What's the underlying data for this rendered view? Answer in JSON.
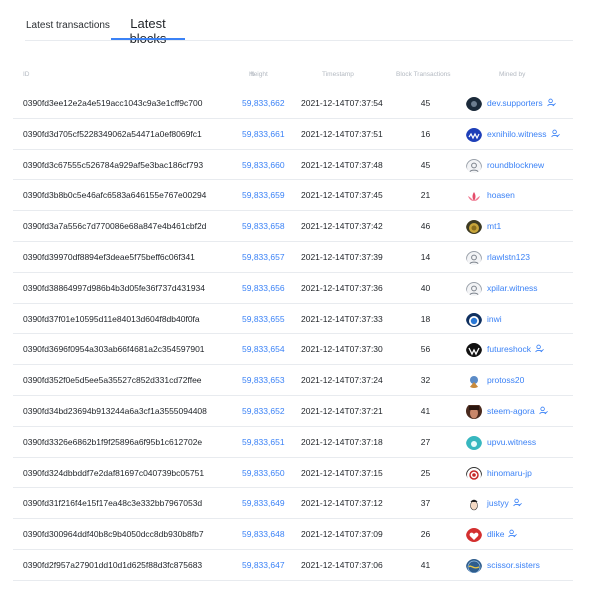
{
  "tabs": {
    "transactions": "Latest transactions",
    "blocks": "Latest blocks"
  },
  "table": {
    "headers": {
      "id": "ID",
      "height": "Height",
      "timestamp": "Timestamp",
      "block_transactions": "Block Transactions",
      "mined_by": "Mined by"
    },
    "rows": [
      {
        "id": "0390fd3ee12e2a4e519acc1043c9a3e1cff9c700",
        "height": "59,833,662",
        "timestamp": "2021-12-14T07:37:54",
        "count": "45",
        "miner": "dev.supporters",
        "verified": true,
        "avatar": "dark-circle-avatar"
      },
      {
        "id": "0390fd3d705cf5228349062a54471a0ef8069fc1",
        "height": "59,833,661",
        "timestamp": "2021-12-14T07:37:51",
        "count": "16",
        "miner": "exnihilo.witness",
        "verified": true,
        "avatar": "blue-wave-avatar"
      },
      {
        "id": "0390fd3c67555c526784a929af5e3bac186cf793",
        "height": "59,833,660",
        "timestamp": "2021-12-14T07:37:48",
        "count": "45",
        "miner": "roundblocknew",
        "verified": false,
        "avatar": "default-user-avatar"
      },
      {
        "id": "0390fd3b8b0c5e46afc6583a646155e767e00294",
        "height": "59,833,659",
        "timestamp": "2021-12-14T07:37:45",
        "count": "21",
        "miner": "hoasen",
        "verified": false,
        "avatar": "lotus-avatar"
      },
      {
        "id": "0390fd3a7a556c7d770086e68a847e4b461cbf2d",
        "height": "59,833,658",
        "timestamp": "2021-12-14T07:37:42",
        "count": "46",
        "miner": "mt1",
        "verified": false,
        "avatar": "gold-coin-avatar"
      },
      {
        "id": "0390fd39970df8894ef3deae5f75beff6c06f341",
        "height": "59,833,657",
        "timestamp": "2021-12-14T07:37:39",
        "count": "14",
        "miner": "rlawlstn123",
        "verified": false,
        "avatar": "default-user-avatar"
      },
      {
        "id": "0390fd38864997d986b4b3d05fe36f737d431934",
        "height": "59,833,656",
        "timestamp": "2021-12-14T07:37:36",
        "count": "40",
        "miner": "xpilar.witness",
        "verified": false,
        "avatar": "default-user-avatar"
      },
      {
        "id": "0390fd37f01e10595d11e84013d604f8db40f0fa",
        "height": "59,833,655",
        "timestamp": "2021-12-14T07:37:33",
        "count": "18",
        "miner": "inwi",
        "verified": false,
        "avatar": "blue-badge-avatar"
      },
      {
        "id": "0390fd3696f0954a303ab66f4681a2c354597901",
        "height": "59,833,654",
        "timestamp": "2021-12-14T07:37:30",
        "count": "56",
        "miner": "futureshock",
        "verified": true,
        "avatar": "black-w-avatar"
      },
      {
        "id": "0390fd352f0e5d5ee5a35527c852d331cd72ffee",
        "height": "59,833,653",
        "timestamp": "2021-12-14T07:37:24",
        "count": "32",
        "miner": "protoss20",
        "verified": false,
        "avatar": "character-avatar"
      },
      {
        "id": "0390fd34bd23694b913244a6a3cf1a3555094408",
        "height": "59,833,652",
        "timestamp": "2021-12-14T07:37:21",
        "count": "41",
        "miner": "steem-agora",
        "verified": true,
        "avatar": "portrait-avatar"
      },
      {
        "id": "0390fd3326e6862b1f9f25896a6f95b1c612702e",
        "height": "59,833,651",
        "timestamp": "2021-12-14T07:37:18",
        "count": "27",
        "miner": "upvu.witness",
        "verified": false,
        "avatar": "teal-circle-avatar"
      },
      {
        "id": "0390fd324dbbddf7e2daf81697c040739bc05751",
        "height": "59,833,650",
        "timestamp": "2021-12-14T07:37:15",
        "count": "25",
        "miner": "hinomaru-jp",
        "verified": false,
        "avatar": "rising-sun-avatar"
      },
      {
        "id": "0390fd31f216f4e15f17ea48c3e332bb7967053d",
        "height": "59,833,649",
        "timestamp": "2021-12-14T07:37:12",
        "count": "37",
        "miner": "justyy",
        "verified": true,
        "avatar": "face-avatar"
      },
      {
        "id": "0390fd300964ddf40b8c9b4050dcc8db930b8fb7",
        "height": "59,833,648",
        "timestamp": "2021-12-14T07:37:09",
        "count": "26",
        "miner": "dlike",
        "verified": true,
        "avatar": "red-heart-avatar"
      },
      {
        "id": "0390fd2f957a27901dd10d1d625f88d3fc875683",
        "height": "59,833,647",
        "timestamp": "2021-12-14T07:37:06",
        "count": "41",
        "miner": "scissor.sisters",
        "verified": false,
        "avatar": "globe-avatar"
      }
    ]
  },
  "colors": {
    "accent": "#3b82f6",
    "border": "#e8ebef",
    "header_text": "#b3b9c1"
  }
}
